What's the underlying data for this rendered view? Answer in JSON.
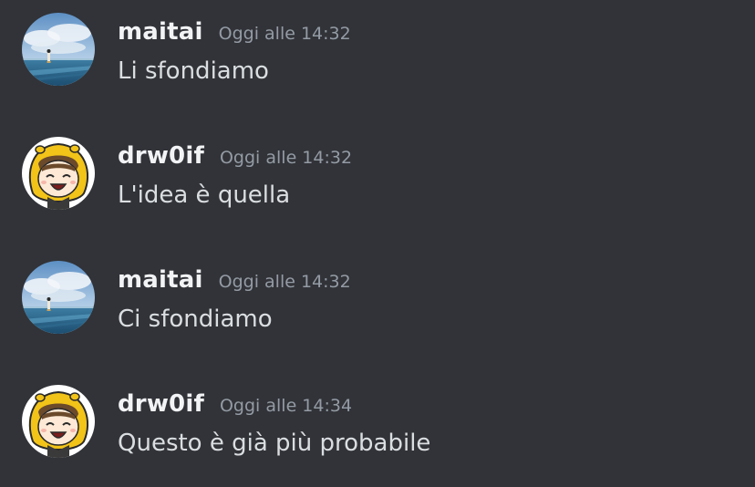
{
  "chat": {
    "messages": [
      {
        "author": "maitai",
        "avatar_icon": "anime-sky-ocean-avatar",
        "timestamp": "Oggi alle 14:32",
        "text": "Li sfondiamo"
      },
      {
        "author": "drw0if",
        "avatar_icon": "yellow-hood-character-avatar",
        "timestamp": "Oggi alle 14:32",
        "text": "L'idea è quella"
      },
      {
        "author": "maitai",
        "avatar_icon": "anime-sky-ocean-avatar",
        "timestamp": "Oggi alle 14:32",
        "text": "Ci sfondiamo"
      },
      {
        "author": "drw0if",
        "avatar_icon": "yellow-hood-character-avatar",
        "timestamp": "Oggi alle 14:34",
        "text": "Questo è già più probabile"
      }
    ]
  },
  "colors": {
    "background": "#313338",
    "username": "#f2f3f5",
    "timestamp": "#949ba4",
    "message_text": "#dbdee1"
  }
}
